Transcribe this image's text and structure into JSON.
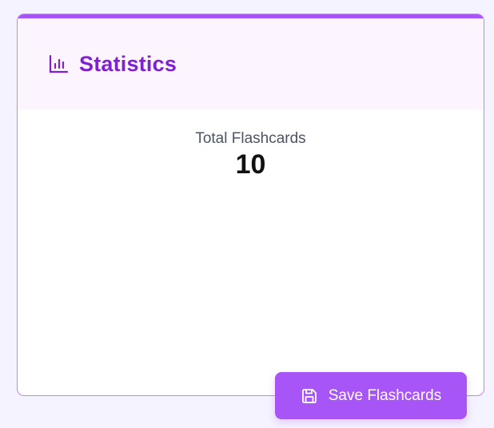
{
  "stats_card": {
    "title": "Statistics",
    "title_icon": "bar-chart-icon",
    "total_label": "Total Flashcards",
    "total_value": "10"
  },
  "save_button": {
    "label": "Save Flashcards",
    "icon": "save-icon"
  },
  "colors": {
    "accent": "#a855f7",
    "title": "#7e22ce",
    "header_bg": "#fcf4ff",
    "page_bg": "#f5f3ff"
  }
}
